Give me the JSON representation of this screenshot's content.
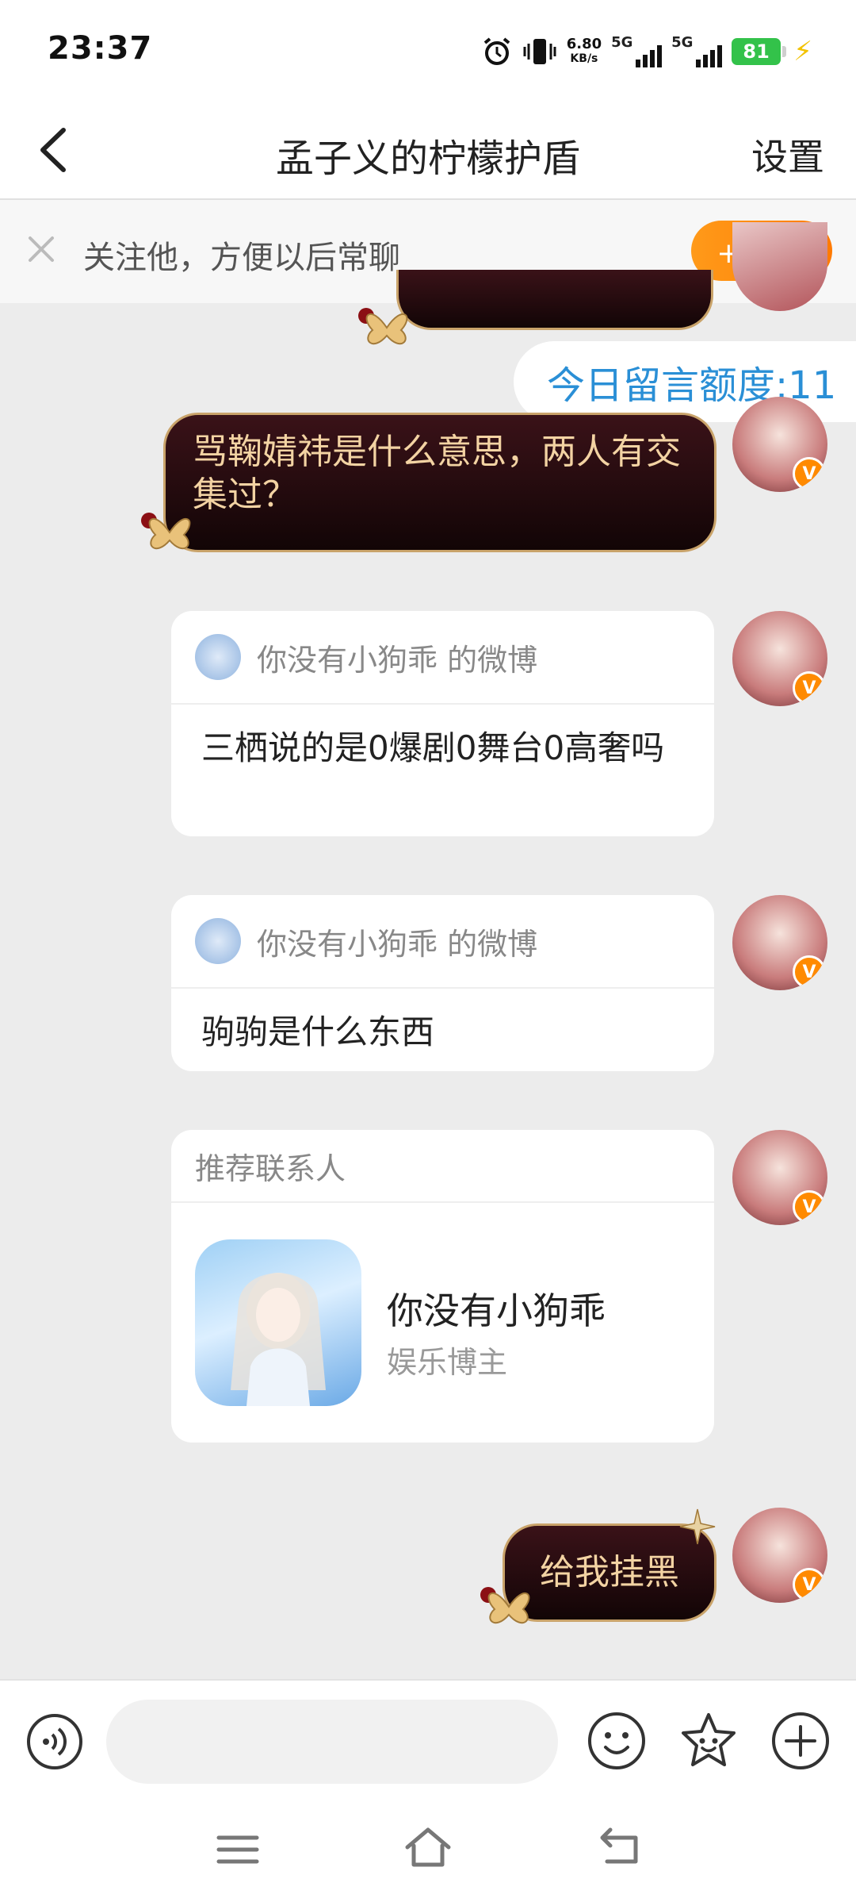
{
  "status_bar": {
    "time": "23:37",
    "net_speed_value": "6.80",
    "net_speed_unit": "KB/s",
    "sim1_label": "5G",
    "sim2_label": "5G",
    "battery": "81",
    "icons": [
      "alarm-icon",
      "vibrate-icon",
      "signal-icon",
      "charging-icon"
    ]
  },
  "header": {
    "title": "孟子义的柠檬护盾",
    "settings_label": "设置"
  },
  "follow_bar": {
    "text": "关注他，方便以后常聊",
    "button_label": "+ 关注",
    "accent": "#ff8a00"
  },
  "chat": {
    "quota_label": "今日留言额度:11",
    "messages": [
      {
        "type": "text",
        "text": "骂鞠婧祎是什么意思，两人有交集过？"
      },
      {
        "type": "shared_post",
        "source": "你没有小狗乖 的微博",
        "text": "三栖说的是0爆剧0舞台0高奢吗"
      },
      {
        "type": "shared_post",
        "source": "你没有小狗乖 的微博",
        "text": "驹驹是什么东西"
      },
      {
        "type": "contact_card",
        "heading": "推荐联系人",
        "name": "你没有小狗乖",
        "subtitle": "娱乐博主"
      },
      {
        "type": "text",
        "text": "给我挂黑"
      }
    ],
    "verified_badge": "V"
  },
  "input_bar": {
    "icons": [
      "voice-icon",
      "emoji-icon",
      "sticker-icon",
      "plus-icon"
    ]
  },
  "nav_bar": {
    "icons": [
      "menu-icon",
      "home-icon",
      "back-nav-icon"
    ]
  }
}
